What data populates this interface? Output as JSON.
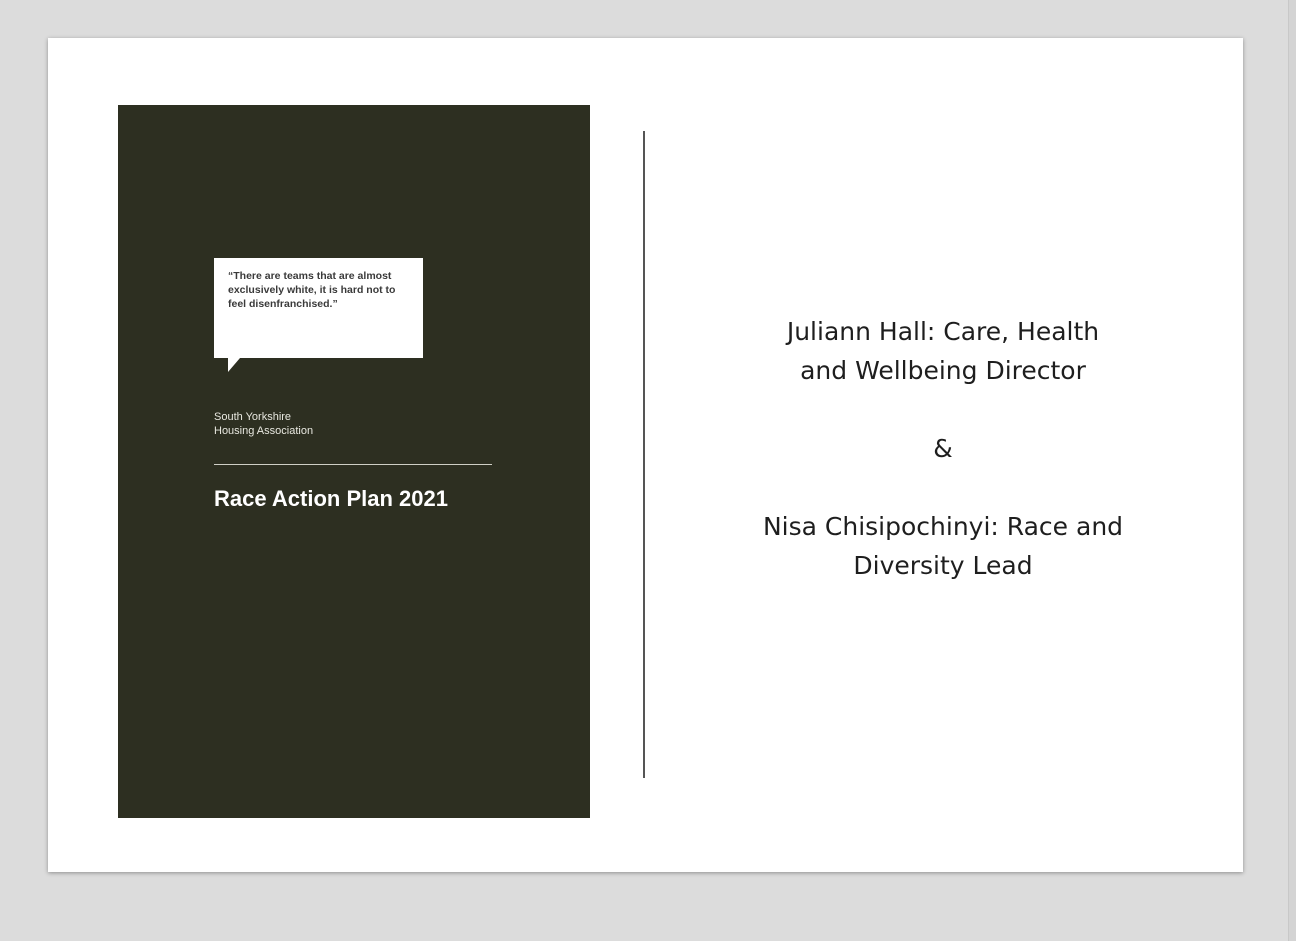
{
  "cover": {
    "quote": "“There are teams that are almost exclusively white, it is hard not to feel disenfranchised.”",
    "org_line1": "South Yorkshire",
    "org_line2": "Housing Association",
    "title": "Race Action Plan 2021"
  },
  "credits": {
    "person1_line1": "Juliann Hall: Care, Health",
    "person1_line2": "and Wellbeing Director",
    "separator": "&",
    "person2_line1": "Nisa Chisipochinyi: Race and",
    "person2_line2": "Diversity Lead"
  },
  "colors": {
    "cover_background": "#2d2f21",
    "slide_background": "#ffffff",
    "viewer_background": "#dcdcdc"
  }
}
